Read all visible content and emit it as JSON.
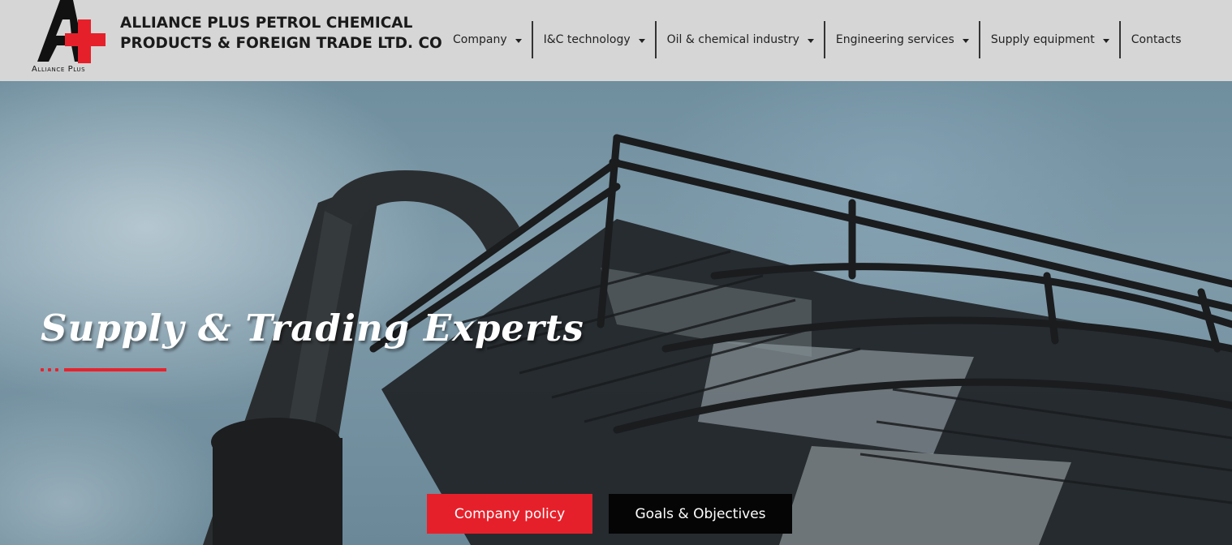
{
  "brand": {
    "logo_caption": "Alliance Plus",
    "name_line1": "ALLIANCE PLUS PETROL CHEMICAL",
    "name_line2": "PRODUCTS & FOREIGN TRADE LTD. CO",
    "colors": {
      "red": "#e6202a",
      "black": "#111111"
    }
  },
  "nav": {
    "items": [
      {
        "label": "Company",
        "has_dropdown": true
      },
      {
        "label": "I&C technology",
        "has_dropdown": true
      },
      {
        "label": "Oil & chemical industry",
        "has_dropdown": true
      },
      {
        "label": "Engineering services",
        "has_dropdown": true
      },
      {
        "label": "Supply equipment",
        "has_dropdown": true
      },
      {
        "label": "Contacts",
        "has_dropdown": false
      }
    ]
  },
  "hero": {
    "title": "Supply & Trading Experts",
    "accent_color": "#e8222c",
    "buttons": {
      "policy_label": "Company policy",
      "goals_label": "Goals & Objectives"
    }
  }
}
